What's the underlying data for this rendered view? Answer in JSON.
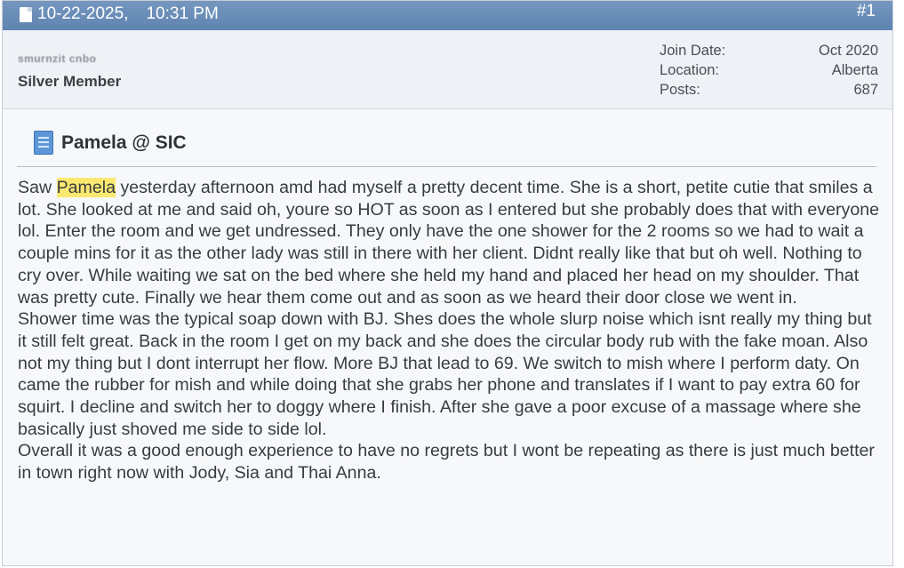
{
  "header": {
    "date": "10-22-2025,",
    "time": "10:31 PM",
    "post_number": "#1"
  },
  "user": {
    "name": "smurnzit cnbo",
    "title": "Silver Member",
    "stats": [
      {
        "label": "Join Date:",
        "value": "Oct 2020"
      },
      {
        "label": "Location:",
        "value": "Alberta"
      },
      {
        "label": "Posts:",
        "value": "687"
      }
    ]
  },
  "post": {
    "title": "Pamela @ SIC",
    "highlight_word": "Pamela",
    "paragraphs": [
      {
        "before": "Saw ",
        "highlight": "Pamela",
        "after": " yesterday afternoon amd had myself a pretty decent time. She is a short, petite cutie that smiles a lot. She looked at me and said oh, youre so HOT as soon as I entered but she probably does that with everyone lol. Enter the room and we get undressed. They only have the one shower for the 2 rooms so we had to wait a couple mins for it as the other lady was still in there with her client. Didnt really like that but oh well. Nothing to cry over. While waiting we sat on the bed where she held my hand and placed her head on my shoulder. That was pretty cute. Finally we hear them come out and as soon as we heard their door close we went in."
      },
      {
        "before": "Shower time was the typical soap down with BJ. Shes does the whole slurp noise which isnt really my thing but it still felt great. Back in the room I get on my back and she does the circular body rub with the fake moan. Also not my thing but I dont interrupt her flow. More BJ that lead to 69. We switch to mish where I perform daty. On came the rubber for mish and while doing that she grabs her phone and translates if I want to pay extra 60 for squirt. I decline and switch her to doggy where I finish. After she gave a poor excuse of a massage where she basically just shoved me side to side lol.",
        "highlight": "",
        "after": ""
      },
      {
        "before": "Overall it was a good enough experience to have no regrets but I wont be repeating as there is just much better in town right now with Jody, Sia and Thai Anna.",
        "highlight": "",
        "after": ""
      }
    ]
  },
  "colors": {
    "header_bg": "#6b8fb8",
    "highlight": "#fbe870"
  }
}
